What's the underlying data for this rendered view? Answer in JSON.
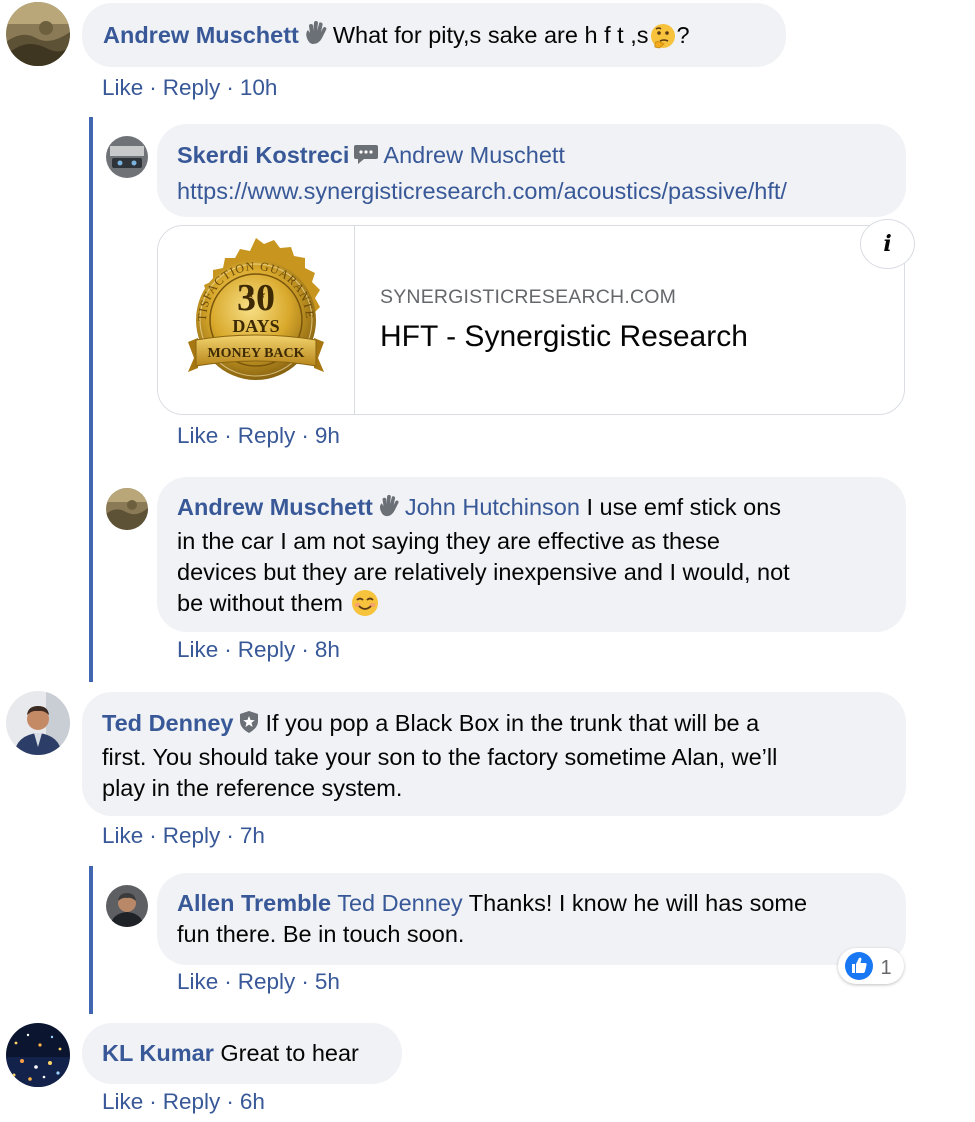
{
  "comments": [
    {
      "author": "Andrew Muschett",
      "text": "What for pity,s sake are h f t ,s",
      "trail": "?",
      "actions": {
        "like": "Like",
        "reply": "Reply",
        "time": "10h"
      }
    },
    {
      "author": "Skerdi Kostreci",
      "mention": "Andrew Muschett",
      "url": "https://www.synergisticresearch.com/acoustics/passive/hft/",
      "preview": {
        "domain": "SYNERGISTICRESEARCH.COM",
        "title": "HFT - Synergistic Research",
        "badge_top": "SATISFACTION GUARANTEED",
        "badge_number": "30",
        "badge_days": "DAYS",
        "badge_ribbon": "MONEY BACK",
        "info_icon": "info-icon"
      },
      "actions": {
        "like": "Like",
        "reply": "Reply",
        "time": "9h"
      }
    },
    {
      "author": "Andrew Muschett",
      "mention": "John Hutchinson",
      "line1": "I use emf stick ons",
      "line2": "in the car I am not saying they are effective as these",
      "line3": "devices but they are relatively inexpensive and I would, not",
      "line4": "be without them",
      "actions": {
        "like": "Like",
        "reply": "Reply",
        "time": "8h"
      }
    },
    {
      "author": "Ted Denney",
      "line1": "If you pop a Black Box in the trunk that will be a",
      "line2": "first. You should take your son to the factory sometime Alan, we’ll",
      "line3": "play in the reference system.",
      "actions": {
        "like": "Like",
        "reply": "Reply",
        "time": "7h"
      }
    },
    {
      "author": "Allen Tremble",
      "mention": "Ted Denney",
      "line1": "Thanks! I know he will has some",
      "line2": "fun there. Be in touch soon.",
      "reaction_count": "1",
      "actions": {
        "like": "Like",
        "reply": "Reply",
        "time": "5h"
      }
    },
    {
      "author": "KL Kumar",
      "text": "Great to hear",
      "actions": {
        "like": "Like",
        "reply": "Reply",
        "time": "6h"
      }
    }
  ],
  "colors": {
    "link": "#385898",
    "bubble": "#f0f2f5",
    "thread": "#4267b2",
    "like_blue": "#1877f2"
  }
}
